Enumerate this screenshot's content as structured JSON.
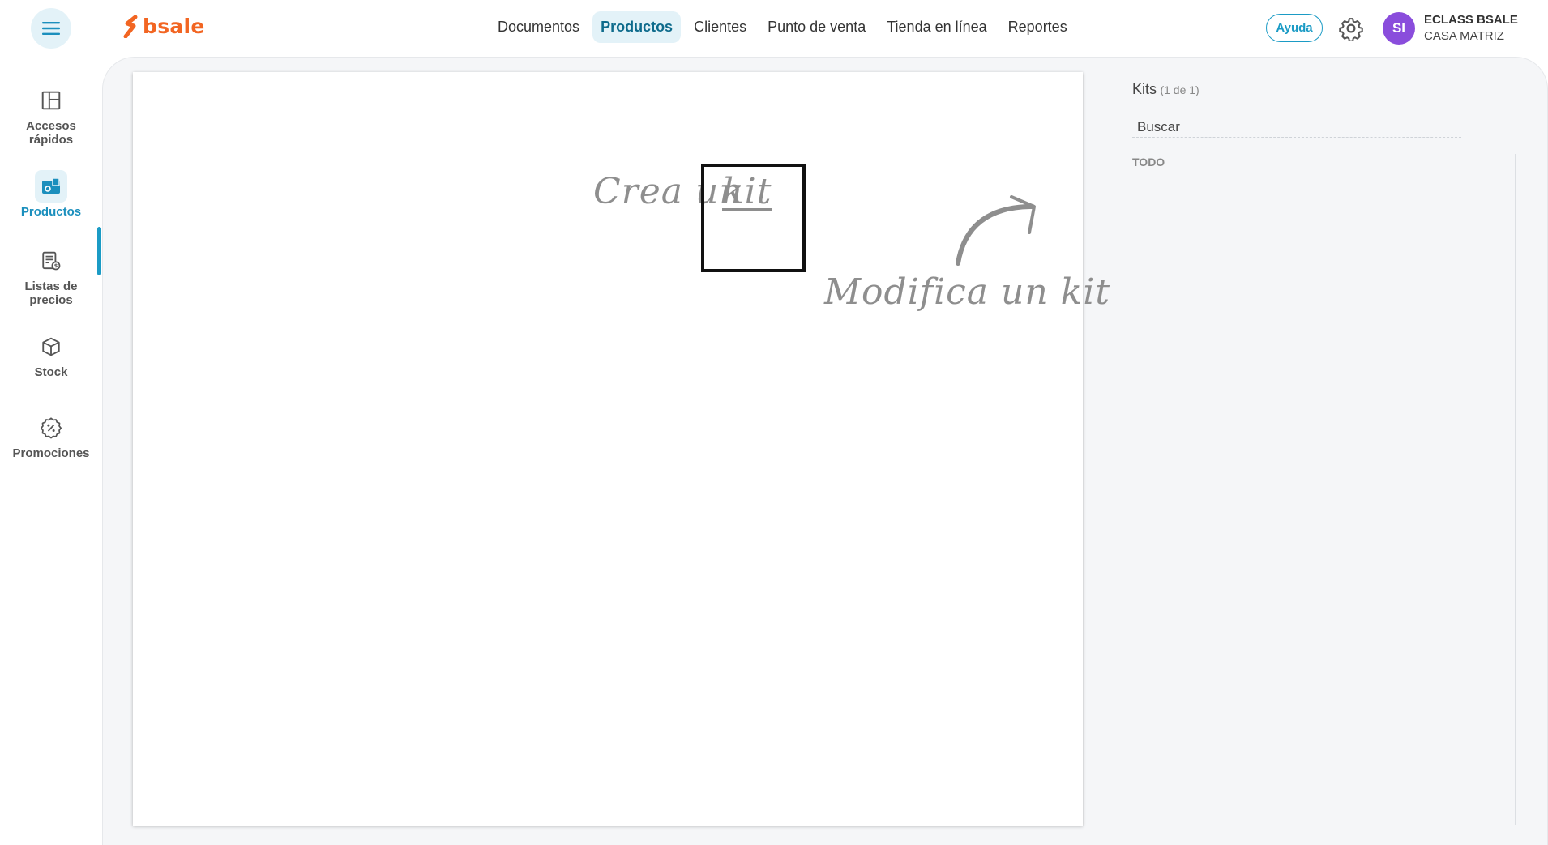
{
  "brand": {
    "name": "bsale",
    "color": "#f26522"
  },
  "nav": {
    "items": [
      {
        "label": "Documentos"
      },
      {
        "label": "Productos",
        "active": true
      },
      {
        "label": "Clientes"
      },
      {
        "label": "Punto de venta"
      },
      {
        "label": "Tienda en línea"
      },
      {
        "label": "Reportes"
      }
    ]
  },
  "header": {
    "help_label": "Ayuda",
    "avatar_initials": "SI",
    "user_name": "ECLASS BSALE",
    "branch": "CASA MATRIZ"
  },
  "sidebar": {
    "items": [
      {
        "label": "Accesos rápidos",
        "icon": "layout-icon"
      },
      {
        "label": "Productos",
        "icon": "products-icon",
        "active": true
      },
      {
        "label": "Listas de precios",
        "icon": "price-list-icon"
      },
      {
        "label": "Stock",
        "icon": "box-icon"
      },
      {
        "label": "Promociones",
        "icon": "promo-badge-icon"
      }
    ]
  },
  "canvas": {
    "create_text_a": "Crea un",
    "create_text_b": "kit",
    "modify_text": "Modifica un kit"
  },
  "panel": {
    "title": "Kits",
    "count": "(1 de 1)",
    "search_placeholder": "Buscar",
    "filter_label": "TODO"
  },
  "colors": {
    "accent": "#1b9bc5",
    "active_bg": "#e3f2f8",
    "avatar": "#8a4ddc"
  }
}
